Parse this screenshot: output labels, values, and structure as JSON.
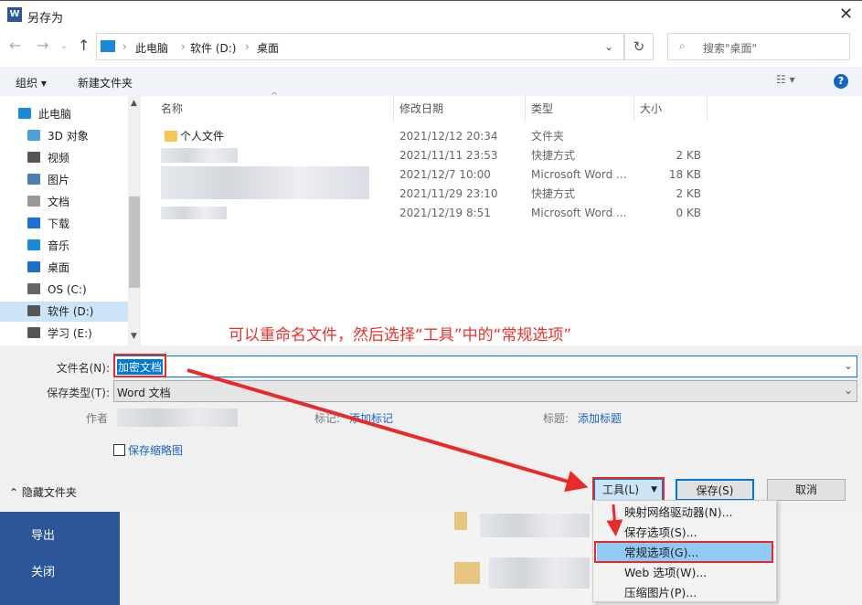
{
  "window": {
    "title": "另存为",
    "app_icon": "W"
  },
  "address": {
    "crumbs": [
      "此电脑",
      "软件 (D:)",
      "桌面"
    ],
    "search_placeholder": "搜索\"桌面\""
  },
  "toolbar": {
    "organize": "组织 ▾",
    "new_folder": "新建文件夹",
    "help": "?"
  },
  "sidebar": {
    "items": [
      {
        "label": "此电脑",
        "color": "#1e88d8"
      },
      {
        "label": "3D 对象",
        "color": "#4aa0d8"
      },
      {
        "label": "视频",
        "color": "#555"
      },
      {
        "label": "图片",
        "color": "#4a7fb0"
      },
      {
        "label": "文档",
        "color": "#777"
      },
      {
        "label": "下载",
        "color": "#1e6fd8"
      },
      {
        "label": "音乐",
        "color": "#1e88d8"
      },
      {
        "label": "桌面",
        "color": "#1e6fc8"
      },
      {
        "label": "OS (C:)",
        "color": "#555"
      },
      {
        "label": "软件 (D:)",
        "color": "#555"
      },
      {
        "label": "学习 (E:)",
        "color": "#555"
      }
    ]
  },
  "columns": [
    "名称",
    "修改日期",
    "类型",
    "大小"
  ],
  "files": [
    {
      "name": "个人文件",
      "date": "2021/12/12 20:34",
      "type": "文件夹",
      "size": ""
    },
    {
      "name": "",
      "date": "2021/11/11 23:53",
      "type": "快捷方式",
      "size": "2 KB"
    },
    {
      "name": "",
      "date": "2021/12/7 10:00",
      "type": "Microsoft Word ...",
      "size": "18 KB"
    },
    {
      "name": "",
      "date": "2021/11/29 23:10",
      "type": "快捷方式",
      "size": "2 KB"
    },
    {
      "name": "",
      "date": "2021/12/19 8:51",
      "type": "Microsoft Word ...",
      "size": "0 KB"
    }
  ],
  "annotation": "可以重命名文件，然后选择“工具”中的“常规选项”",
  "form": {
    "filename_label": "文件名(N):",
    "filename": "加密文档",
    "type_label": "保存类型(T):",
    "type": "Word 文档",
    "author_label": "作者",
    "tags_label": "标记:",
    "tags_link": "添加标记",
    "title_label": "标题:",
    "title_link": "添加标题",
    "thumb_label": "保存缩略图",
    "hide_folders": "隐藏文件夹"
  },
  "buttons": {
    "tools": "工具(L)",
    "save": "保存(S)",
    "cancel": "取消"
  },
  "menu": [
    "映射网络驱动器(N)...",
    "保存选项(S)...",
    "常规选项(G)...",
    "Web 选项(W)...",
    "压缩图片(P)..."
  ],
  "background": {
    "export": "导出",
    "close": "关闭"
  }
}
